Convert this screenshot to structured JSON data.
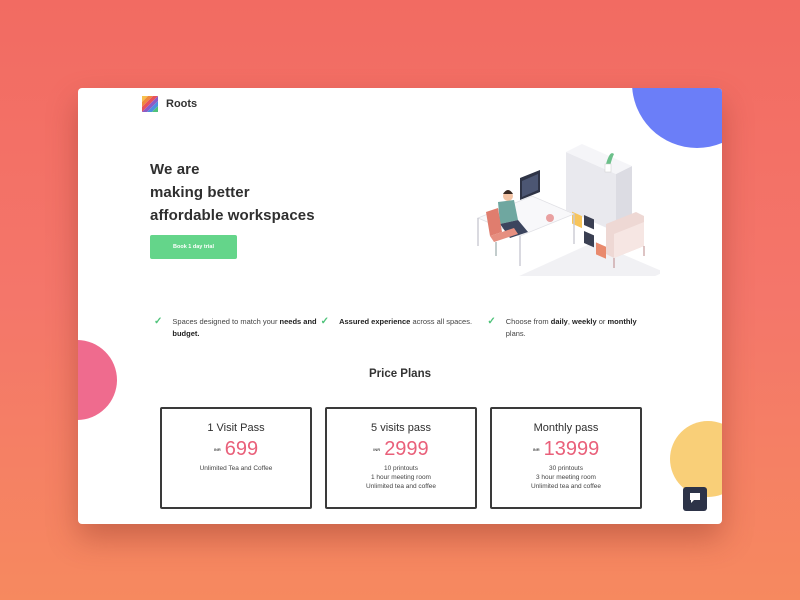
{
  "brand": {
    "name": "Roots"
  },
  "hero": {
    "title_lines": [
      "We are",
      "making better",
      "affordable workspaces"
    ],
    "cta_label": "Book 1 day trial"
  },
  "features": [
    {
      "segments": [
        {
          "text": "Spaces designed to match your ",
          "bold": false
        },
        {
          "text": "needs and budget.",
          "bold": true
        }
      ]
    },
    {
      "segments": [
        {
          "text": "Assured experience",
          "bold": true
        },
        {
          "text": " across all spaces.",
          "bold": false
        }
      ]
    },
    {
      "segments": [
        {
          "text": "Choose from ",
          "bold": false
        },
        {
          "text": "daily",
          "bold": true
        },
        {
          "text": ", ",
          "bold": false
        },
        {
          "text": "weekly",
          "bold": true
        },
        {
          "text": " or ",
          "bold": false
        },
        {
          "text": "monthly",
          "bold": true
        },
        {
          "text": " plans.",
          "bold": false
        }
      ]
    }
  ],
  "pricing": {
    "title": "Price Plans",
    "currency": "INR",
    "plans": [
      {
        "name": "1 Visit Pass",
        "price": "699",
        "features": [
          "Unlimited Tea and Coffee"
        ]
      },
      {
        "name": "5 visits pass",
        "price": "2999",
        "features": [
          "10 printouts",
          "1 hour meeting room",
          "Unlimited tea and coffee"
        ]
      },
      {
        "name": "Monthly pass",
        "price": "13999",
        "features": [
          "30 printouts",
          "3 hour meeting room",
          "Unlimited tea and coffee"
        ]
      }
    ]
  },
  "icons": {
    "feature": "check-icon",
    "chat": "chat-bubble-icon",
    "illustration": "workspace-illustration"
  },
  "colors": {
    "accent_green": "#64d58a",
    "price_pink": "#e9607a",
    "blob_blue": "#6b7ef8",
    "blob_pink": "#ef6b8e",
    "blob_yellow": "#f9cf78",
    "background": "#f26b62"
  }
}
